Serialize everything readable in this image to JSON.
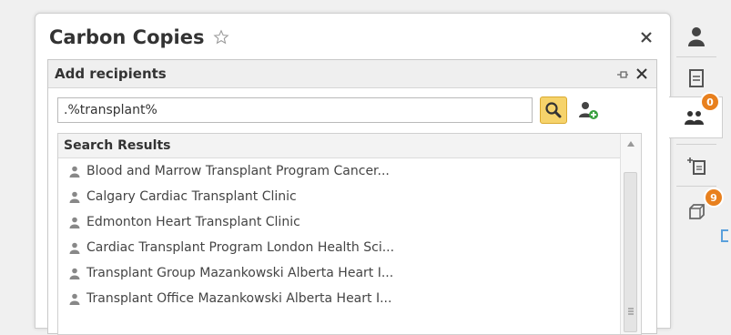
{
  "panel": {
    "title": "Carbon Copies",
    "star_icon": "star-outline-icon",
    "close_icon": "close-icon"
  },
  "dialog": {
    "title": "Add recipients",
    "pin_icon": "pin-icon",
    "close_icon": "close-icon"
  },
  "search": {
    "value": ".%transplant%",
    "search_icon": "magnifier-icon",
    "add_contact_icon": "add-contact-icon"
  },
  "results": {
    "header": "Search Results",
    "items": [
      {
        "label": "Blood and Marrow Transplant Program Cancer..."
      },
      {
        "label": "Calgary Cardiac Transplant Clinic"
      },
      {
        "label": "Edmonton Heart Transplant Clinic"
      },
      {
        "label": "Cardiac Transplant Program London Health Sci..."
      },
      {
        "label": "Transplant Group Mazankowski Alberta Heart I..."
      },
      {
        "label": "Transplant Office Mazankowski Alberta Heart I..."
      }
    ]
  },
  "side_tabs": {
    "tabs": [
      {
        "icon": "person-icon"
      },
      {
        "icon": "document-icon"
      },
      {
        "icon": "people-icon",
        "badge": "0"
      },
      {
        "icon": "add-document-icon"
      },
      {
        "icon": "copies-icon",
        "badge": "9"
      }
    ]
  },
  "colors": {
    "accent_badge": "#e8801e",
    "search_button": "#f6d36b"
  }
}
